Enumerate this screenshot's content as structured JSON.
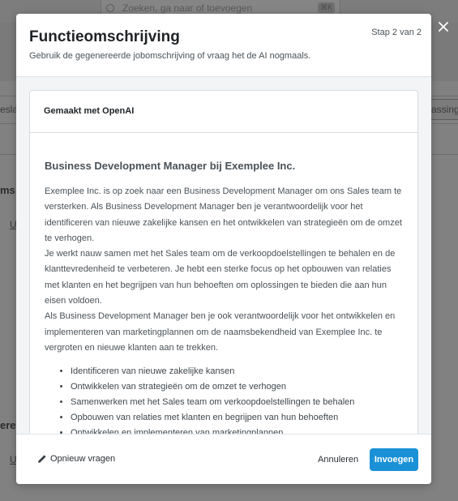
{
  "background": {
    "search_placeholder": "Zoeken, ga naar of toevoegen",
    "search_shortcut": "⌘K",
    "partial_labels": [
      "esla",
      "assing",
      "ms",
      "Ui",
      "erei",
      "U"
    ]
  },
  "modal": {
    "title": "Functieomschrijving",
    "subtitle": "Gebruik de gegenereerde jobomschrijving of vraag het de AI nogmaals.",
    "step": "Stap 2 van 2",
    "close_icon": "close-icon",
    "card": {
      "header": "Gemaakt met OpenAI",
      "job_title": "Business Development Manager bij Exemplee Inc.",
      "paragraphs": [
        "Exemplee Inc. is op zoek naar een Business Development Manager om ons Sales team te versterken. Als Business Development Manager ben je verantwoordelijk voor het identificeren van nieuwe zakelijke kansen en het ontwikkelen van strategieën om de omzet te verhogen.",
        "Je werkt nauw samen met het Sales team om de verkoopdoelstellingen te behalen en de klanttevredenheid te verbeteren. Je hebt een sterke focus op het opbouwen van relaties met klanten en het begrijpen van hun behoeften om oplossingen te bieden die aan hun eisen voldoen.",
        "Als Business Development Manager ben je ook verantwoordelijk voor het ontwikkelen en implementeren van marketingplannen om de naamsbekendheid van Exemplee Inc. te vergroten en nieuwe klanten aan te trekken."
      ],
      "bullets": [
        "Identificeren van nieuwe zakelijke kansen",
        "Ontwikkelen van strategieën om de omzet te verhogen",
        "Samenwerken met het Sales team om verkoopdoelstellingen te behalen",
        "Opbouwen van relaties met klanten en begrijpen van hun behoeften",
        "Ontwikkelen en implementeren van marketingplannen"
      ]
    },
    "footer": {
      "ask_again": "Opnieuw vragen",
      "cancel": "Annuleren",
      "insert": "Invoegen"
    }
  },
  "colors": {
    "primary": "#1a91d6",
    "overlay": "#7a7a7a"
  }
}
